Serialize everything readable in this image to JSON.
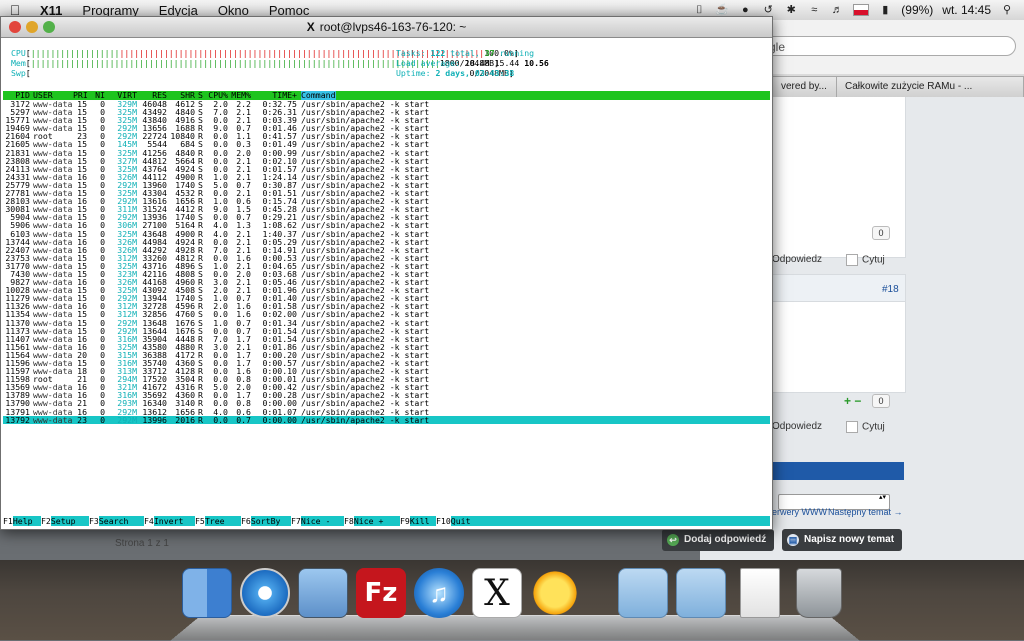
{
  "menubar": {
    "app_name": "X11",
    "items": [
      "Programy",
      "Edycja",
      "Okno",
      "Pomoc"
    ],
    "battery": "(99%)",
    "clock": "wt. 14:45"
  },
  "browser": {
    "search_placeholder": "gle",
    "tabs": [
      "vered by...",
      "Całkowite zużycie RAMu - ..."
    ],
    "badges": [
      "0",
      "0"
    ],
    "reply_label": "Odpowiedz",
    "quote_label": "Cytuj",
    "post_number": "#18",
    "plus_minus": "+ −",
    "link_servers": "erwery WWW",
    "link_next": "Następny temat →",
    "pager": "Strona 1 z 1",
    "add_reply_button": "Dodaj odpowiedź",
    "new_topic_button": "Napisz nowy temat"
  },
  "terminal": {
    "title": "root@lvps46-163-76-120: ~",
    "meters": {
      "cpu_label": "CPU",
      "cpu_value": "100.0%",
      "mem_label": "Mem",
      "mem_value": "1800/2048MB",
      "swp_label": "Swp",
      "swp_value": "0/2048MB",
      "tasks_label": "Tasks:",
      "tasks_total": "122",
      "tasks_total_suffix": "total,",
      "tasks_running": "37",
      "tasks_running_suffix": "running",
      "load_label": "Load average:",
      "load_1": "18.48",
      "load_5": "15.44",
      "load_15": "10.56",
      "uptime_label": "Uptime:",
      "uptime_value": "2 days, 03:43:38"
    },
    "header": [
      "PID",
      "USER",
      "PRI",
      "NI",
      "VIRT",
      "RES",
      "SHR",
      "S",
      "CPU%",
      "MEM%",
      "TIME+",
      "Command"
    ],
    "processes": [
      [
        "3172",
        "www-data",
        "15",
        "0",
        "329M",
        "46048",
        "4612",
        "S",
        "2.0",
        "2.2",
        "0:32.75",
        "/usr/sbin/apache2 -k start"
      ],
      [
        "5297",
        "www-data",
        "15",
        "0",
        "325M",
        "43492",
        "4840",
        "S",
        "7.0",
        "2.1",
        "0:26.31",
        "/usr/sbin/apache2 -k start"
      ],
      [
        "15771",
        "www-data",
        "15",
        "0",
        "325M",
        "43840",
        "4916",
        "S",
        "0.0",
        "2.1",
        "0:03.39",
        "/usr/sbin/apache2 -k start"
      ],
      [
        "19469",
        "www-data",
        "15",
        "0",
        "292M",
        "13656",
        "1688",
        "R",
        "9.0",
        "0.7",
        "0:01.46",
        "/usr/sbin/apache2 -k start"
      ],
      [
        "21604",
        "root",
        "23",
        "0",
        "292M",
        "22724",
        "10840",
        "R",
        "0.0",
        "1.1",
        "0:41.57",
        "/usr/sbin/apache2 -k start"
      ],
      [
        "21605",
        "www-data",
        "15",
        "0",
        "145M",
        "5544",
        "684",
        "S",
        "0.0",
        "0.3",
        "0:01.49",
        "/usr/sbin/apache2 -k start"
      ],
      [
        "21831",
        "www-data",
        "15",
        "0",
        "325M",
        "41256",
        "4840",
        "R",
        "0.0",
        "2.0",
        "0:00.99",
        "/usr/sbin/apache2 -k start"
      ],
      [
        "23808",
        "www-data",
        "15",
        "0",
        "327M",
        "44812",
        "5664",
        "R",
        "0.0",
        "2.1",
        "0:02.10",
        "/usr/sbin/apache2 -k start"
      ],
      [
        "24113",
        "www-data",
        "15",
        "0",
        "325M",
        "43764",
        "4924",
        "S",
        "0.0",
        "2.1",
        "0:01.57",
        "/usr/sbin/apache2 -k start"
      ],
      [
        "24331",
        "www-data",
        "16",
        "0",
        "326M",
        "44112",
        "4900",
        "R",
        "1.0",
        "2.1",
        "1:24.14",
        "/usr/sbin/apache2 -k start"
      ],
      [
        "25779",
        "www-data",
        "15",
        "0",
        "292M",
        "13960",
        "1740",
        "S",
        "5.0",
        "0.7",
        "0:30.87",
        "/usr/sbin/apache2 -k start"
      ],
      [
        "27781",
        "www-data",
        "15",
        "0",
        "325M",
        "43304",
        "4532",
        "R",
        "0.0",
        "2.1",
        "0:01.51",
        "/usr/sbin/apache2 -k start"
      ],
      [
        "28103",
        "www-data",
        "16",
        "0",
        "292M",
        "13616",
        "1656",
        "R",
        "1.0",
        "0.6",
        "0:15.74",
        "/usr/sbin/apache2 -k start"
      ],
      [
        "30081",
        "www-data",
        "15",
        "0",
        "311M",
        "31524",
        "4412",
        "R",
        "9.0",
        "1.5",
        "0:45.28",
        "/usr/sbin/apache2 -k start"
      ],
      [
        "5904",
        "www-data",
        "15",
        "0",
        "292M",
        "13936",
        "1740",
        "S",
        "0.0",
        "0.7",
        "0:29.21",
        "/usr/sbin/apache2 -k start"
      ],
      [
        "5906",
        "www-data",
        "16",
        "0",
        "306M",
        "27100",
        "5164",
        "R",
        "4.0",
        "1.3",
        "1:08.62",
        "/usr/sbin/apache2 -k start"
      ],
      [
        "6103",
        "www-data",
        "15",
        "0",
        "325M",
        "43648",
        "4900",
        "R",
        "4.0",
        "2.1",
        "1:40.37",
        "/usr/sbin/apache2 -k start"
      ],
      [
        "13744",
        "www-data",
        "16",
        "0",
        "326M",
        "44984",
        "4924",
        "R",
        "0.0",
        "2.1",
        "0:05.29",
        "/usr/sbin/apache2 -k start"
      ],
      [
        "22407",
        "www-data",
        "16",
        "0",
        "326M",
        "44292",
        "4928",
        "R",
        "7.0",
        "2.1",
        "0:14.91",
        "/usr/sbin/apache2 -k start"
      ],
      [
        "23753",
        "www-data",
        "15",
        "0",
        "312M",
        "33260",
        "4812",
        "R",
        "0.0",
        "1.6",
        "0:00.53",
        "/usr/sbin/apache2 -k start"
      ],
      [
        "31770",
        "www-data",
        "15",
        "0",
        "325M",
        "43716",
        "4896",
        "S",
        "1.0",
        "2.1",
        "0:04.65",
        "/usr/sbin/apache2 -k start"
      ],
      [
        "7430",
        "www-data",
        "15",
        "0",
        "323M",
        "42116",
        "4808",
        "S",
        "0.0",
        "2.0",
        "0:03.68",
        "/usr/sbin/apache2 -k start"
      ],
      [
        "9827",
        "www-data",
        "16",
        "0",
        "326M",
        "44168",
        "4960",
        "R",
        "3.0",
        "2.1",
        "0:05.46",
        "/usr/sbin/apache2 -k start"
      ],
      [
        "10028",
        "www-data",
        "15",
        "0",
        "325M",
        "43092",
        "4508",
        "S",
        "2.0",
        "2.1",
        "0:01.96",
        "/usr/sbin/apache2 -k start"
      ],
      [
        "11279",
        "www-data",
        "15",
        "0",
        "292M",
        "13944",
        "1740",
        "S",
        "1.0",
        "0.7",
        "0:01.40",
        "/usr/sbin/apache2 -k start"
      ],
      [
        "11326",
        "www-data",
        "16",
        "0",
        "312M",
        "32728",
        "4596",
        "R",
        "2.0",
        "1.6",
        "0:01.58",
        "/usr/sbin/apache2 -k start"
      ],
      [
        "11354",
        "www-data",
        "15",
        "0",
        "312M",
        "32856",
        "4760",
        "S",
        "0.0",
        "1.6",
        "0:02.00",
        "/usr/sbin/apache2 -k start"
      ],
      [
        "11370",
        "www-data",
        "15",
        "0",
        "292M",
        "13648",
        "1676",
        "S",
        "1.0",
        "0.7",
        "0:01.34",
        "/usr/sbin/apache2 -k start"
      ],
      [
        "11373",
        "www-data",
        "15",
        "0",
        "292M",
        "13644",
        "1676",
        "S",
        "0.0",
        "0.7",
        "0:01.54",
        "/usr/sbin/apache2 -k start"
      ],
      [
        "11407",
        "www-data",
        "16",
        "0",
        "316M",
        "35904",
        "4448",
        "R",
        "7.0",
        "1.7",
        "0:01.54",
        "/usr/sbin/apache2 -k start"
      ],
      [
        "11561",
        "www-data",
        "16",
        "0",
        "325M",
        "43580",
        "4880",
        "R",
        "3.0",
        "2.1",
        "0:01.86",
        "/usr/sbin/apache2 -k start"
      ],
      [
        "11564",
        "www-data",
        "20",
        "0",
        "315M",
        "36388",
        "4172",
        "R",
        "0.0",
        "1.7",
        "0:00.20",
        "/usr/sbin/apache2 -k start"
      ],
      [
        "11596",
        "www-data",
        "15",
        "0",
        "316M",
        "35740",
        "4360",
        "S",
        "0.0",
        "1.7",
        "0:00.57",
        "/usr/sbin/apache2 -k start"
      ],
      [
        "11597",
        "www-data",
        "18",
        "0",
        "313M",
        "33712",
        "4128",
        "R",
        "0.0",
        "1.6",
        "0:00.10",
        "/usr/sbin/apache2 -k start"
      ],
      [
        "11598",
        "root",
        "21",
        "0",
        "294M",
        "17520",
        "3504",
        "R",
        "0.0",
        "0.8",
        "0:00.01",
        "/usr/sbin/apache2 -k start"
      ],
      [
        "13569",
        "www-data",
        "16",
        "0",
        "321M",
        "41672",
        "4316",
        "R",
        "5.0",
        "2.0",
        "0:00.42",
        "/usr/sbin/apache2 -k start"
      ],
      [
        "13789",
        "www-data",
        "16",
        "0",
        "316M",
        "35692",
        "4360",
        "R",
        "0.0",
        "1.7",
        "0:00.28",
        "/usr/sbin/apache2 -k start"
      ],
      [
        "13790",
        "www-data",
        "21",
        "0",
        "293M",
        "16340",
        "3140",
        "R",
        "0.0",
        "0.8",
        "0:00.00",
        "/usr/sbin/apache2 -k start"
      ],
      [
        "13791",
        "www-data",
        "16",
        "0",
        "292M",
        "13612",
        "1656",
        "R",
        "4.0",
        "0.6",
        "0:01.07",
        "/usr/sbin/apache2 -k start"
      ],
      [
        "13792",
        "www-data",
        "23",
        "0",
        "292M",
        "13996",
        "2016",
        "R",
        "0.0",
        "0.7",
        "0:00.00",
        "/usr/sbin/apache2 -k start"
      ]
    ],
    "fkeys": [
      [
        "F1",
        "Help"
      ],
      [
        "F2",
        "Setup"
      ],
      [
        "F3",
        "Search"
      ],
      [
        "F4",
        "Invert"
      ],
      [
        "F5",
        "Tree"
      ],
      [
        "F6",
        "SortBy"
      ],
      [
        "F7",
        "Nice -"
      ],
      [
        "F8",
        "Nice +"
      ],
      [
        "F9",
        "Kill"
      ],
      [
        "F10",
        "Quit"
      ]
    ]
  },
  "dock": {
    "icons": [
      "finder-icon",
      "safari-icon",
      "preview-icon",
      "filezilla-icon",
      "itunes-icon",
      "x11-icon",
      "sun-icon",
      "applications-folder-icon",
      "documents-folder-icon",
      "file-icon",
      "trash-icon"
    ],
    "filezilla_glyph": "Fz",
    "x11_glyph": "X"
  },
  "colors": {
    "htop_header_green": "#1ec41e",
    "htop_selected_cyan": "#18c6c6",
    "forum_blue": "#1f5aa8"
  }
}
